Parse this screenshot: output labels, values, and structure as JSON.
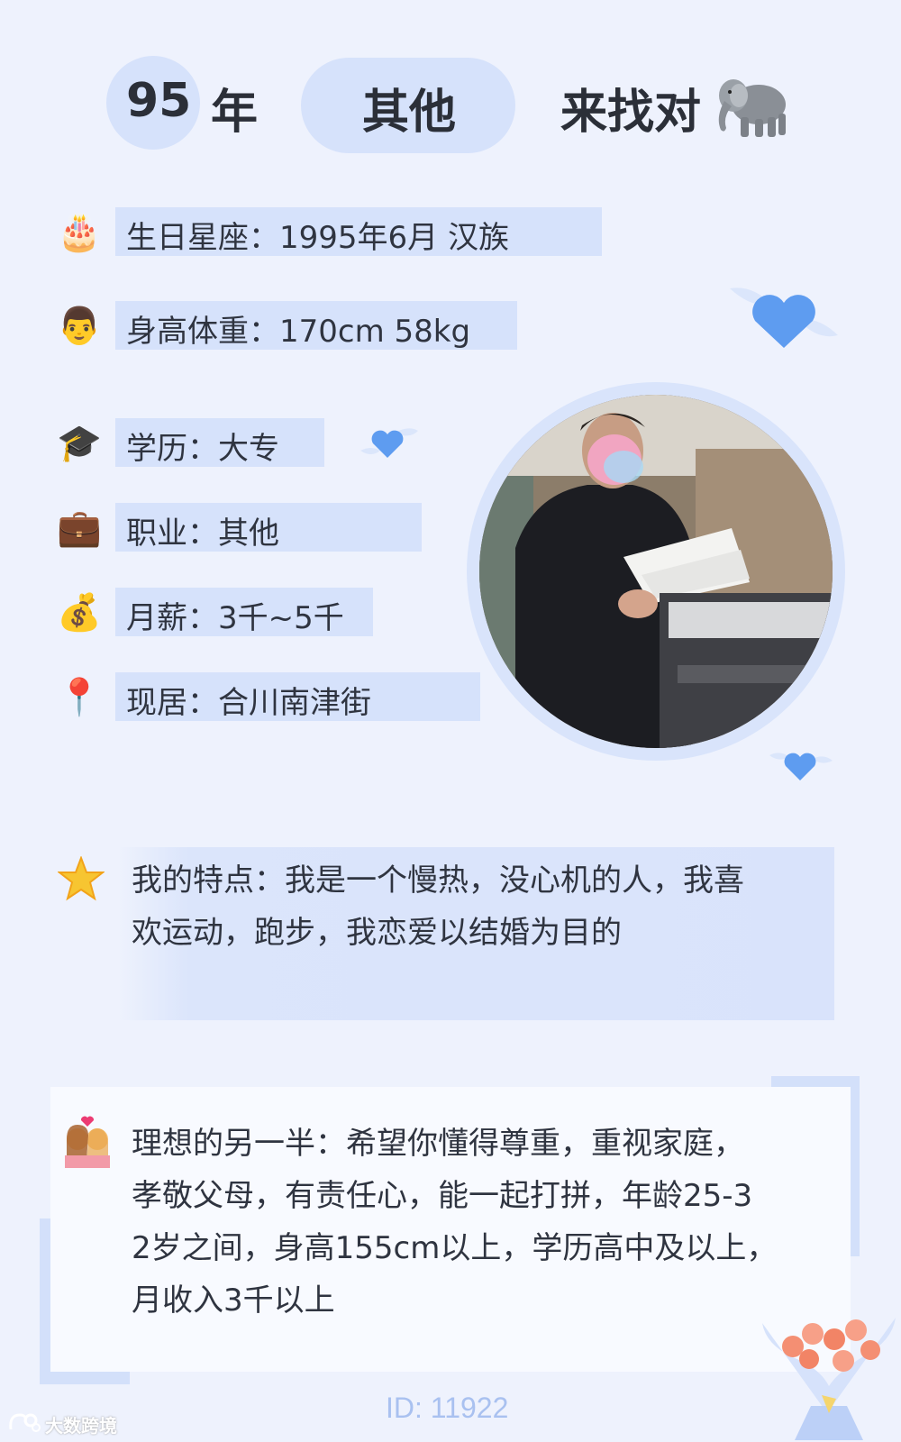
{
  "header": {
    "year": "95",
    "year_unit": "年",
    "job": "其他",
    "slogan": "来找对",
    "mascot_icon": "elephant-icon"
  },
  "info": [
    {
      "icon": "cake-icon",
      "glyph": "🎂",
      "text": "生日星座：1995年6月 汉族"
    },
    {
      "icon": "man-face-icon",
      "glyph": "👨",
      "text": "身高体重：170cm 58kg"
    },
    {
      "icon": "graduation-cap-icon",
      "glyph": "🎓",
      "text": "学历：大专"
    },
    {
      "icon": "briefcase-icon",
      "glyph": "💼",
      "text": "职业：其他"
    },
    {
      "icon": "money-bag-icon",
      "glyph": "💰",
      "text": "月薪：3千~5千"
    },
    {
      "icon": "location-pin-icon",
      "glyph": "📍",
      "text": "现居：合川南津街"
    }
  ],
  "traits": {
    "icon": "star-icon",
    "line1": "我的特点：我是一个慢热，没心机的人，我喜",
    "line2": "欢运动，跑步，我恋爱以结婚为目的"
  },
  "ideal": {
    "icon": "couple-icon",
    "line1": "理想的另一半：希望你懂得尊重，重视家庭，",
    "line2": "孝敬父母，有责任心，能一起打拼，年龄25-3",
    "line3": "2岁之间，身高155cm以上，学历高中及以上，",
    "line4": "月收入3千以上"
  },
  "footer": {
    "id_text": "ID: 11922",
    "watermark": "大数跨境"
  },
  "colors": {
    "background": "#eef2fd",
    "highlight": "#d6e2fb",
    "heart": "#5e9cf0",
    "id_text": "#a9c1f0"
  }
}
